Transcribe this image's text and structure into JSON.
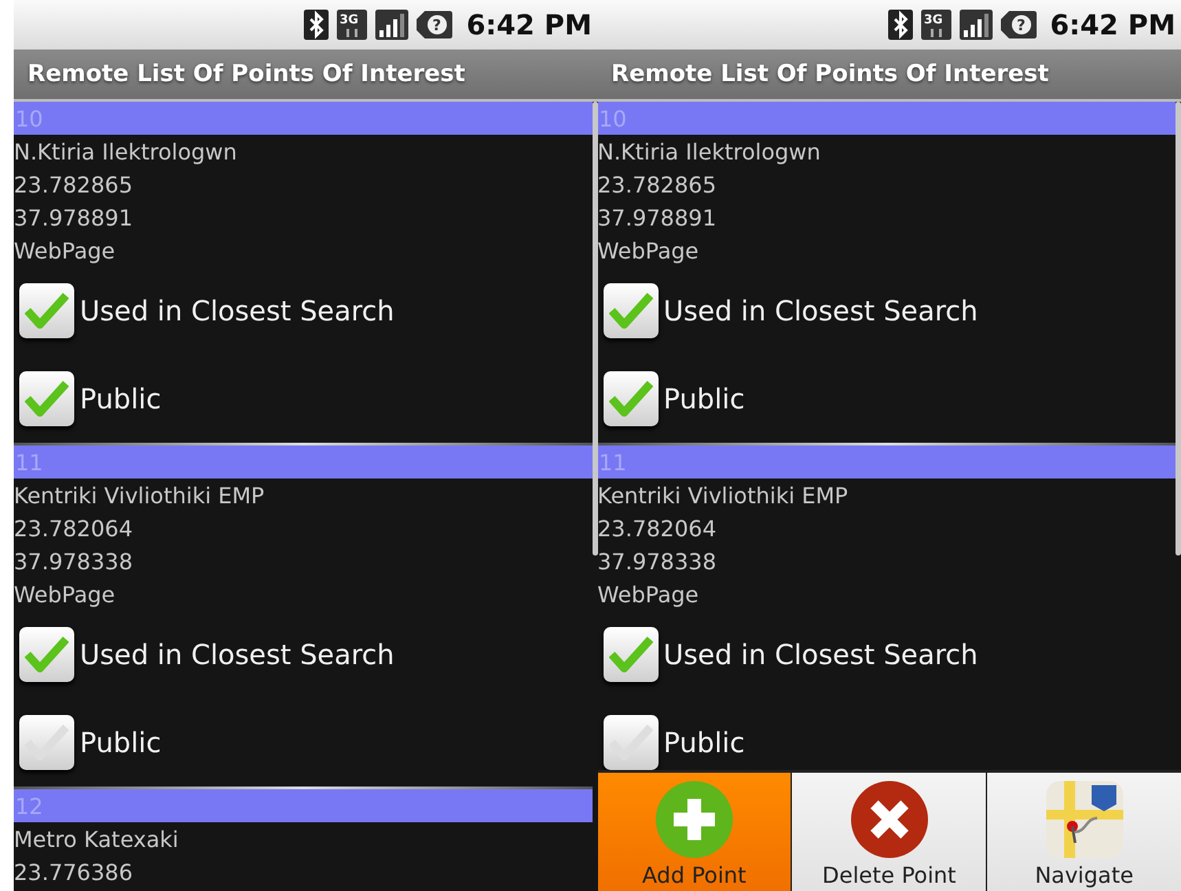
{
  "screens": [
    {
      "status_bar": {
        "network": "3G",
        "battery": "?",
        "time": "6:42 PM"
      },
      "title": "Remote List Of Points Of Interest",
      "points": [
        {
          "number": "10",
          "lines": [
            "N.Ktiria Ilektrologwn",
            "23.782865",
            "37.978891",
            "WebPage"
          ],
          "options": [
            {
              "label": "Used in Closest Search",
              "checked": true
            },
            {
              "label": "Public",
              "checked": true
            }
          ]
        },
        {
          "number": "11",
          "lines": [
            "Kentriki Vivliothiki EMP",
            "23.782064",
            "37.978338",
            "WebPage"
          ],
          "options": [
            {
              "label": "Used in Closest Search",
              "checked": true
            },
            {
              "label": "Public",
              "checked": false
            }
          ]
        },
        {
          "number": "12",
          "lines": [
            "Metro Katexaki",
            "23.776386"
          ]
        }
      ]
    },
    {
      "status_bar": {
        "network": "3G",
        "battery": "?",
        "time": "6:42 PM"
      },
      "title": "Remote List Of Points Of Interest",
      "points": [
        {
          "number": "10",
          "lines": [
            "N.Ktiria Ilektrologwn",
            "23.782865",
            "37.978891",
            "WebPage"
          ],
          "options": [
            {
              "label": "Used in Closest Search",
              "checked": true
            },
            {
              "label": "Public",
              "checked": true
            }
          ]
        },
        {
          "number": "11",
          "lines": [
            "Kentriki Vivliothiki EMP",
            "23.782064",
            "37.978338",
            "WebPage"
          ],
          "options": [
            {
              "label": "Used in Closest Search",
              "checked": true
            },
            {
              "label": "Public",
              "checked": false
            }
          ]
        }
      ],
      "menu": [
        {
          "kind": "add",
          "label": "Add Point",
          "selected": true
        },
        {
          "kind": "delete",
          "label": "Delete Point",
          "selected": false
        },
        {
          "kind": "map",
          "label": "Navigate",
          "selected": false
        }
      ]
    }
  ]
}
